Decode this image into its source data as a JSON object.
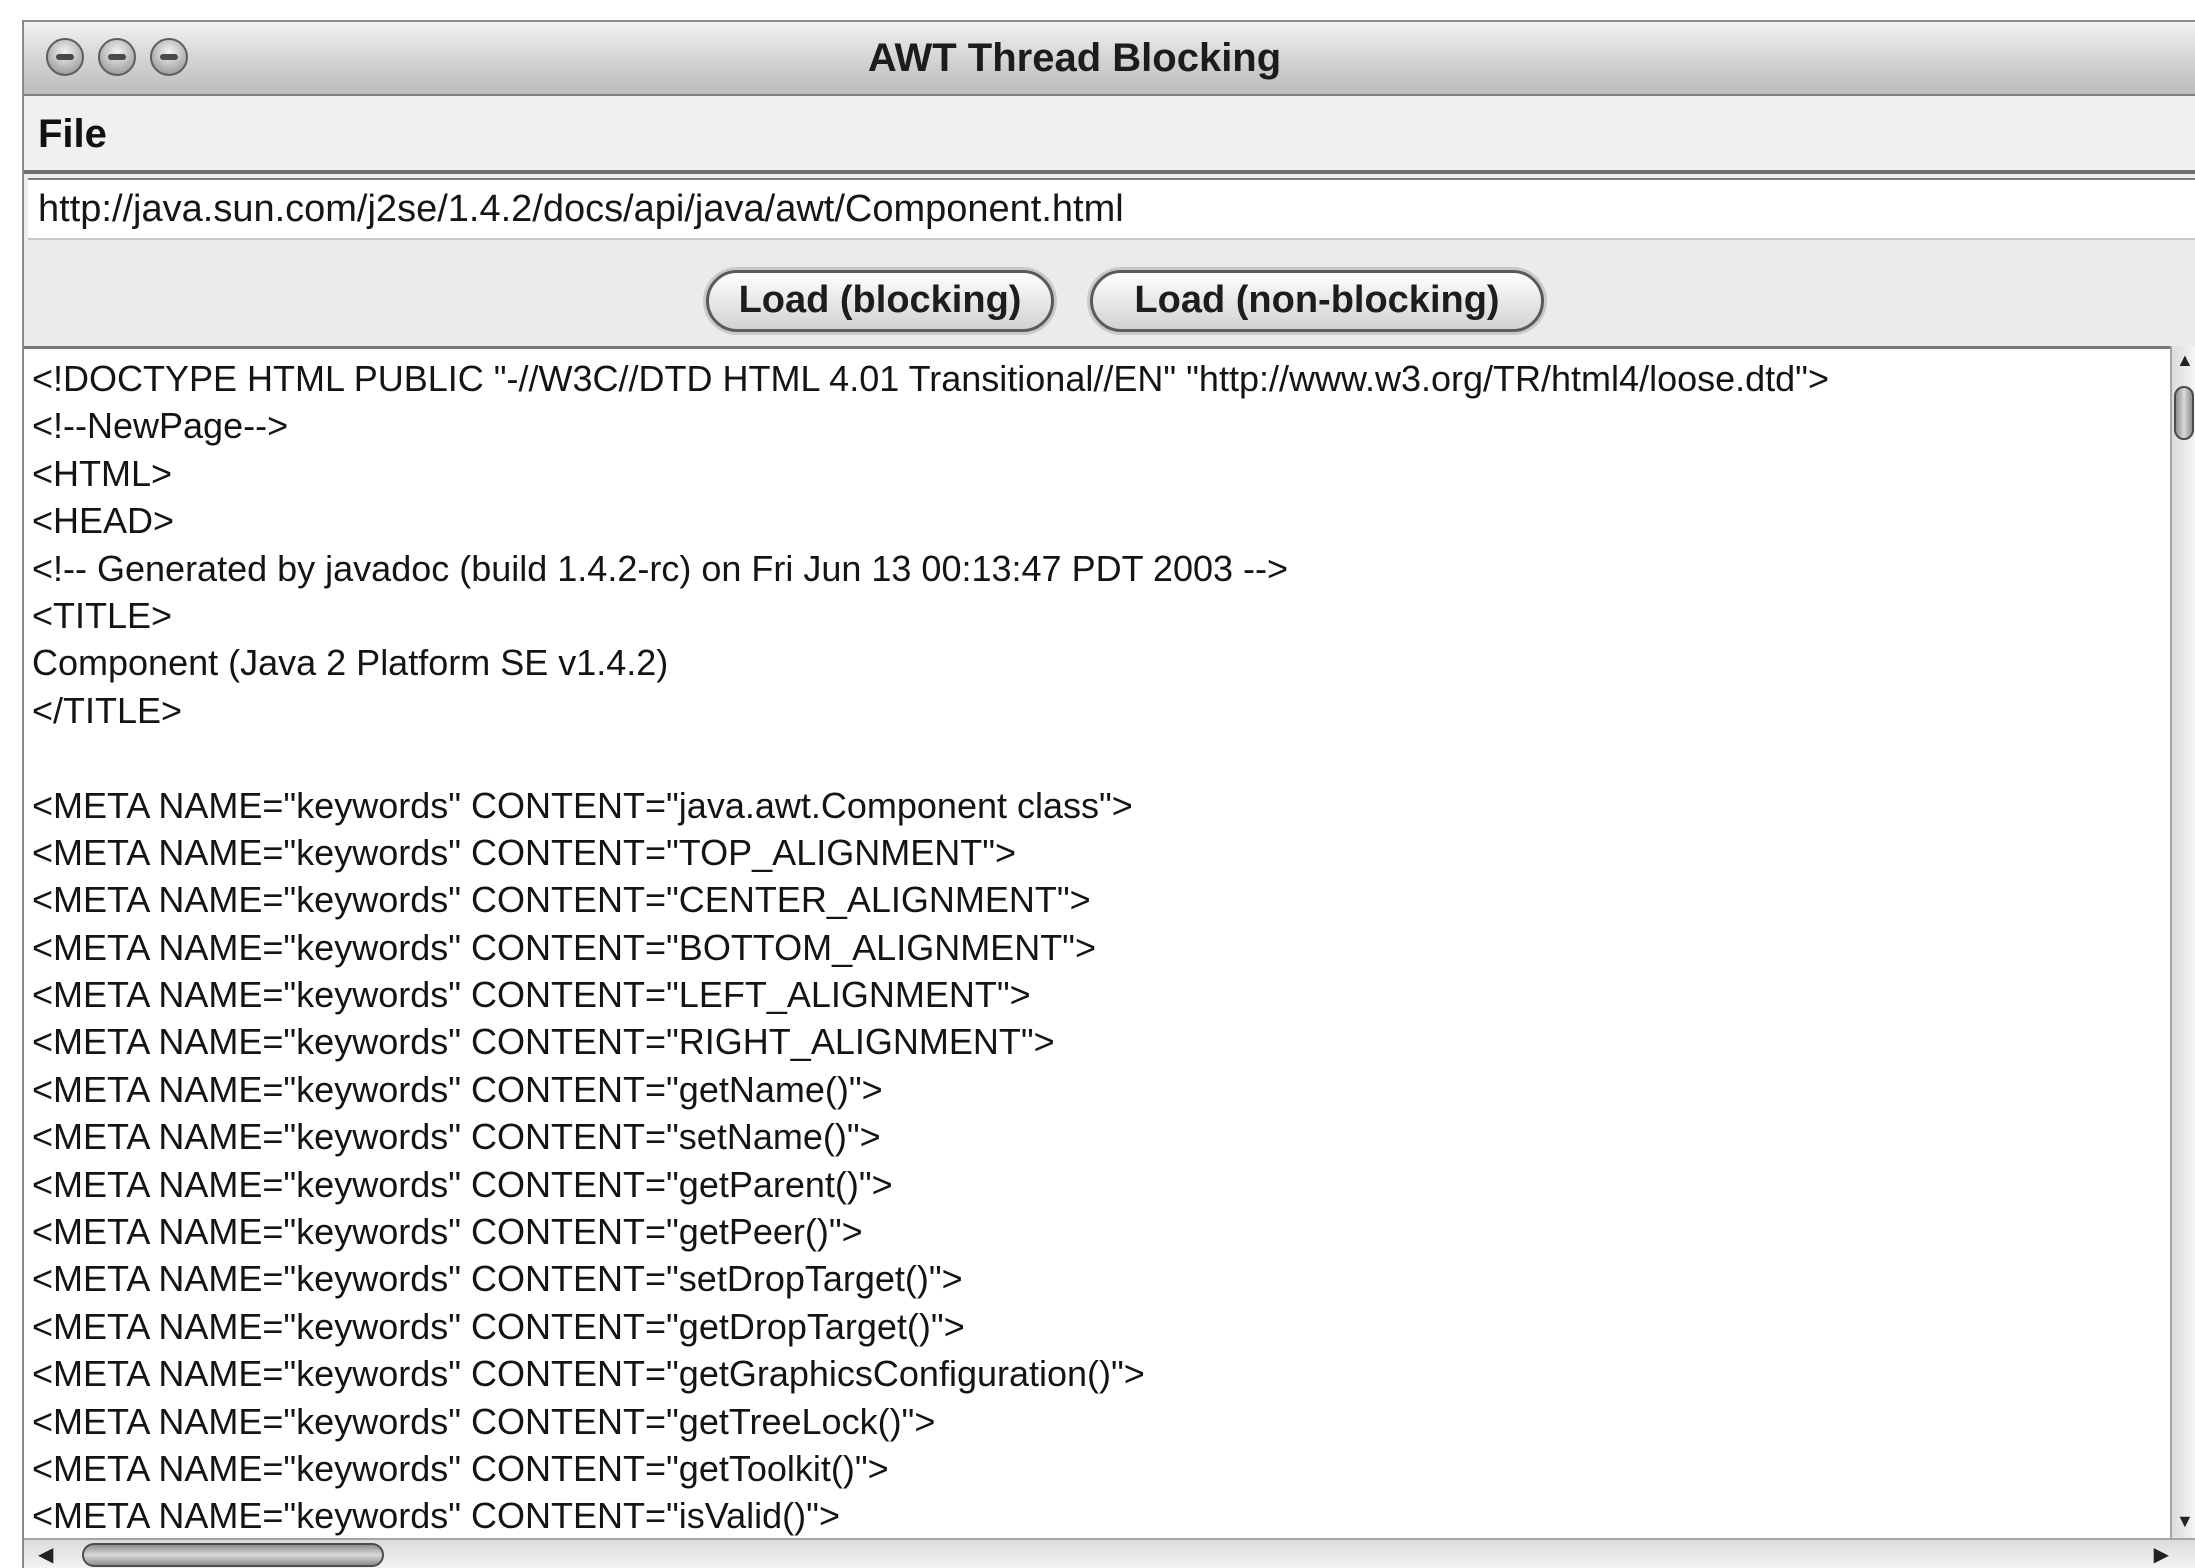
{
  "window": {
    "title": "AWT Thread Blocking"
  },
  "menu": {
    "file_label": "File"
  },
  "url_field": {
    "value": "http://java.sun.com/j2se/1.4.2/docs/api/java/awt/Component.html"
  },
  "buttons": {
    "load_blocking": "Load (blocking)",
    "load_nonblocking": "Load (non-blocking)"
  },
  "content": {
    "lines": [
      "<!DOCTYPE HTML PUBLIC \"-//W3C//DTD HTML 4.01 Transitional//EN\" \"http://www.w3.org/TR/html4/loose.dtd\">",
      "<!--NewPage-->",
      "<HTML>",
      "<HEAD>",
      "<!-- Generated by javadoc (build 1.4.2-rc) on Fri Jun 13 00:13:47 PDT 2003 -->",
      "<TITLE>",
      "Component (Java 2 Platform SE v1.4.2)",
      "</TITLE>",
      "",
      "<META NAME=\"keywords\" CONTENT=\"java.awt.Component class\">",
      "<META NAME=\"keywords\" CONTENT=\"TOP_ALIGNMENT\">",
      "<META NAME=\"keywords\" CONTENT=\"CENTER_ALIGNMENT\">",
      "<META NAME=\"keywords\" CONTENT=\"BOTTOM_ALIGNMENT\">",
      "<META NAME=\"keywords\" CONTENT=\"LEFT_ALIGNMENT\">",
      "<META NAME=\"keywords\" CONTENT=\"RIGHT_ALIGNMENT\">",
      "<META NAME=\"keywords\" CONTENT=\"getName()\">",
      "<META NAME=\"keywords\" CONTENT=\"setName()\">",
      "<META NAME=\"keywords\" CONTENT=\"getParent()\">",
      "<META NAME=\"keywords\" CONTENT=\"getPeer()\">",
      "<META NAME=\"keywords\" CONTENT=\"setDropTarget()\">",
      "<META NAME=\"keywords\" CONTENT=\"getDropTarget()\">",
      "<META NAME=\"keywords\" CONTENT=\"getGraphicsConfiguration()\">",
      "<META NAME=\"keywords\" CONTENT=\"getTreeLock()\">",
      "<META NAME=\"keywords\" CONTENT=\"getToolkit()\">",
      "<META NAME=\"keywords\" CONTENT=\"isValid()\">"
    ]
  },
  "icons": {
    "close": "close-icon",
    "minimize": "minimize-icon",
    "zoom": "zoom-icon",
    "scroll_up": "arrow-up-icon",
    "scroll_down": "arrow-down-icon",
    "scroll_left": "arrow-left-icon",
    "scroll_right": "arrow-right-icon"
  }
}
